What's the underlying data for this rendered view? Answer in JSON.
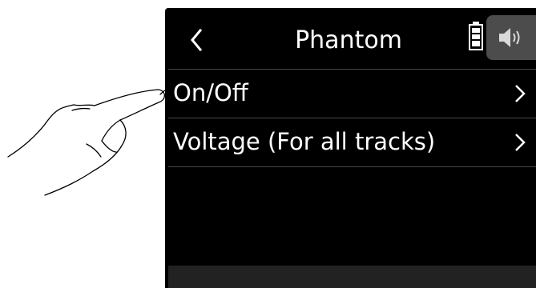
{
  "header": {
    "title": "Phantom"
  },
  "menu": {
    "items": [
      {
        "label": "On/Off"
      },
      {
        "label": "Voltage (For all tracks)"
      }
    ]
  },
  "icons": {
    "back": "chevron-left-icon",
    "battery": "battery-icon",
    "speaker": "speaker-icon",
    "chevron": "chevron-right-icon",
    "hand": "pointing-hand-icon"
  },
  "colors": {
    "screen_bg": "#000000",
    "text": "#ffffff",
    "divider": "#4a4a4a",
    "speaker_tab_bg": "#4c4c4c"
  }
}
